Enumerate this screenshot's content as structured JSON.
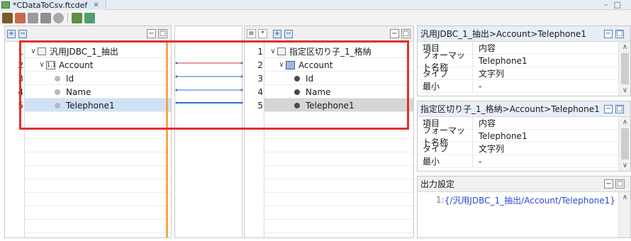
{
  "tab": {
    "label": "*CDataToCsv.ftcdef",
    "close": "✕"
  },
  "window": {
    "min": "–",
    "max": "□"
  },
  "left_tree": {
    "rows": [
      {
        "num": "1",
        "chev": "∨",
        "label": "汎用JDBC_1_抽出"
      },
      {
        "num": "2",
        "chev": "∨",
        "label": "Account"
      },
      {
        "num": "3",
        "label": "Id"
      },
      {
        "num": "4",
        "label": "Name"
      },
      {
        "num": "5",
        "label": "Telephone1"
      }
    ]
  },
  "right_tree": {
    "rows": [
      {
        "num": "1",
        "chev": "∨",
        "label": "指定区切り子_1_格納"
      },
      {
        "num": "2",
        "chev": "∨",
        "label": "Account"
      },
      {
        "num": "3",
        "label": "Id"
      },
      {
        "num": "4",
        "label": "Name"
      },
      {
        "num": "5",
        "label": "Telephone1"
      }
    ]
  },
  "mapping_colors": {
    "red": "#d9363e",
    "blue": "#2f6fcf",
    "highlight": "#e03030"
  },
  "props_top": {
    "title": "汎用JDBC_1_抽出>Account>Telephone1",
    "rows": [
      {
        "k": "項目",
        "v": "内容"
      },
      {
        "k": "フォーマット名称",
        "v": "Telephone1"
      },
      {
        "k": "タイプ",
        "v": "文字列"
      },
      {
        "k": "最小",
        "v": "-"
      }
    ]
  },
  "props_mid": {
    "title": "指定区切り子_1_格納>Account>Telephone1",
    "rows": [
      {
        "k": "項目",
        "v": "内容"
      },
      {
        "k": "フォーマット名称",
        "v": "Telephone1"
      },
      {
        "k": "タイプ",
        "v": "文字列"
      },
      {
        "k": "最小",
        "v": "-"
      }
    ]
  },
  "output": {
    "title": "出力設定",
    "line_num": "1:",
    "line_text": "{/汎用JDBC_1_抽出/Account/Telephone1}"
  }
}
